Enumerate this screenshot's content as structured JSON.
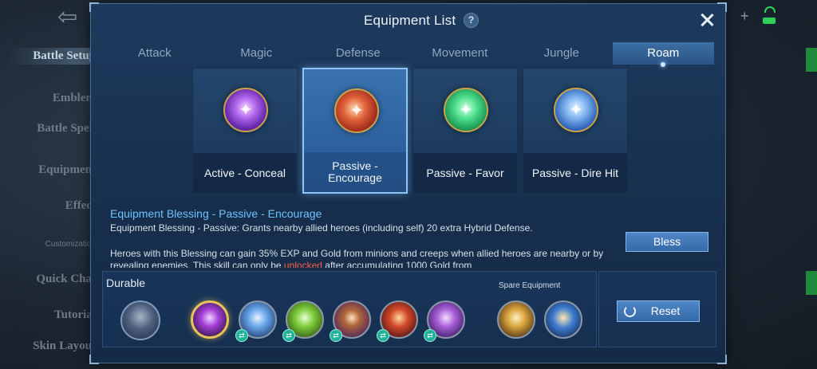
{
  "background": {
    "back_arrow": "⇦",
    "sidebar": [
      {
        "label": "Battle Setup",
        "name": "bg-sidebar-battle-setup"
      },
      {
        "label": "Emblem",
        "name": "bg-sidebar-emblem"
      },
      {
        "label": "Battle Spell",
        "name": "bg-sidebar-battle-spell"
      },
      {
        "label": "Equipment",
        "name": "bg-sidebar-equipment"
      },
      {
        "label": "Effect",
        "name": "bg-sidebar-effect"
      },
      {
        "label": "Customization",
        "name": "bg-sidebar-customization"
      },
      {
        "label": "Quick Chat",
        "name": "bg-sidebar-quick-chat"
      },
      {
        "label": "Tutorial",
        "name": "bg-sidebar-tutorial"
      },
      {
        "label": "Skin Layout",
        "name": "bg-sidebar-skin-layout"
      }
    ],
    "plus": "+"
  },
  "panel": {
    "title": "Equipment List",
    "help_glyph": "?"
  },
  "tabs": [
    "Attack",
    "Magic",
    "Defense",
    "Movement",
    "Jungle",
    "Roam"
  ],
  "active_tab": "Roam",
  "blessings": [
    {
      "label": "Active - Conceal",
      "icon": "conceal-icon"
    },
    {
      "label": "Passive - Encourage",
      "icon": "encourage-icon"
    },
    {
      "label": "Passive - Favor",
      "icon": "favor-icon"
    },
    {
      "label": "Passive - Dire Hit",
      "icon": "dire-hit-icon"
    }
  ],
  "selected_blessing": "Passive - Encourage",
  "description": {
    "title": "Equipment Blessing - Passive - Encourage",
    "line1": "Equipment Blessing -  Passive: Grants nearby allied heroes (including self) 20 extra Hybrid Defense.",
    "line2_a": "Heroes with this Blessing can gain 35% EXP and Gold from minions and creeps when allied heroes are nearby or by revealing enemies. This skill can only be ",
    "line2_highlight": "unlocked",
    "line2_b": " after accumulating 1000 Gold from"
  },
  "bless_button": "Bless",
  "loadout": {
    "title": "Durable",
    "spare_title": "Spare Equipment",
    "items": [
      {
        "name": "roam-boots-encourage-item",
        "color": "#a43fd8",
        "equipped": true,
        "swap": false
      },
      {
        "name": "blue-item",
        "color": "#6aa6ea",
        "equipped": false,
        "swap": true
      },
      {
        "name": "green-item",
        "color": "#7fcc3a",
        "equipped": false,
        "swap": true
      },
      {
        "name": "bronze-item",
        "color": "#b0683a",
        "equipped": false,
        "swap": true
      },
      {
        "name": "red-item",
        "color": "#d2482a",
        "equipped": false,
        "swap": true
      },
      {
        "name": "violet-item",
        "color": "#a860d8",
        "equipped": false,
        "swap": true
      }
    ],
    "spare_items": [
      {
        "name": "spare-gold-item",
        "color": "#d8a43a"
      },
      {
        "name": "spare-blue-gold-item",
        "color": "#3b7bd0"
      }
    ],
    "swap_glyph": "⇄"
  },
  "reset_button": "Reset"
}
